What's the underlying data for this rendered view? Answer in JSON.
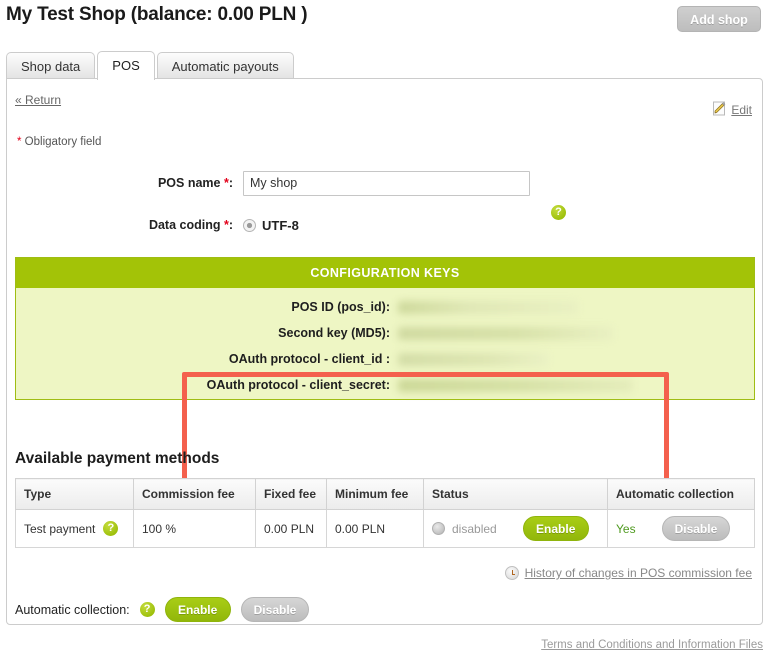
{
  "header": {
    "title": "My Test Shop (balance: 0.00 PLN )",
    "add_shop_label": "Add shop"
  },
  "tabs": [
    {
      "label": "Shop data",
      "active": false
    },
    {
      "label": "POS",
      "active": true
    },
    {
      "label": "Automatic payouts",
      "active": false
    }
  ],
  "panel": {
    "return_label": "« Return",
    "edit_label": "Edit",
    "edit_icon": "pencil-icon",
    "obligatory_star": "*",
    "obligatory_text": " Obligatory field"
  },
  "form": {
    "pos_name": {
      "label": "POS name ",
      "star": "*",
      "colon": ":",
      "value": "My shop",
      "placeholder": ""
    },
    "data_coding": {
      "label": "Data coding ",
      "star": "*",
      "colon": ":",
      "option": "UTF-8",
      "help_icon": "?"
    }
  },
  "config_keys": {
    "heading": "CONFIGURATION KEYS",
    "rows": [
      {
        "label": "POS ID (pos_id):",
        "value": ""
      },
      {
        "label": "Second key (MD5):",
        "value": ""
      },
      {
        "label": "OAuth protocol - client_id :",
        "value": ""
      },
      {
        "label": "OAuth protocol - client_secret:",
        "value": ""
      }
    ],
    "highlight_color": "#f4604d",
    "header_color": "#a3c307",
    "body_color": "#eef6c4"
  },
  "payments": {
    "section_title": "Available payment methods",
    "columns": [
      "Type",
      "Commission fee",
      "Fixed fee",
      "Minimum fee",
      "Status",
      "Automatic collection"
    ],
    "rows": [
      {
        "type": "Test payment",
        "type_help_icon": "?",
        "commission_fee": "100 %",
        "fixed_fee": "0.00 PLN",
        "minimum_fee": "0.00 PLN",
        "status_text": "disabled",
        "status_button": "Enable",
        "automatic_collection_value": "Yes",
        "automatic_collection_button": "Disable"
      }
    ]
  },
  "history": {
    "icon": "clock-icon",
    "label": "History of changes in POS commission fee"
  },
  "automatic_collection": {
    "label": "Automatic collection:",
    "help_icon": "?",
    "enable_label": "Enable",
    "disable_label": "Disable"
  },
  "footer": {
    "terms_label": "Terms and Conditions and Information Files"
  }
}
